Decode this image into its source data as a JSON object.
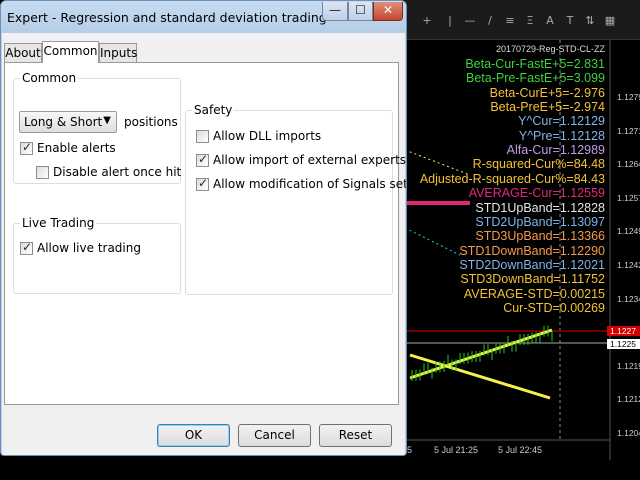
{
  "dialog": {
    "title": "Expert - Regression and standard deviation trading",
    "window_buttons": {
      "minimize": "—",
      "maximize": "☐",
      "close": "✕"
    },
    "tabs": [
      {
        "label": "About",
        "active": false
      },
      {
        "label": "Common",
        "active": true
      },
      {
        "label": "Inputs",
        "active": false
      }
    ],
    "common_group": {
      "label": "Common",
      "positions_select": {
        "value": "Long & Short",
        "suffix": "positions"
      },
      "enable_alerts": {
        "label": "Enable alerts",
        "checked": true
      },
      "disable_alert_once_hit": {
        "label": "Disable alert once hit",
        "checked": false
      }
    },
    "live_trading_group": {
      "label": "Live Trading",
      "allow_live_trading": {
        "label": "Allow live trading",
        "checked": true
      }
    },
    "safety_group": {
      "label": "Safety",
      "allow_dll": {
        "label": "Allow DLL imports",
        "checked": false
      },
      "allow_external_experts": {
        "label": "Allow import of external experts",
        "checked": true
      },
      "allow_signals_mod": {
        "label": "Allow modification of Signals settings",
        "checked": true
      }
    },
    "buttons": {
      "ok": "OK",
      "cancel": "Cancel",
      "reset": "Reset"
    }
  },
  "chart": {
    "title": "20170729-Reg-STD-CL-ZZ",
    "indicators": [
      {
        "text": "Beta-Cur-FastE+5=2.831",
        "color": "#3cd23c"
      },
      {
        "text": "Beta-Pre-FastE+5=3.099",
        "color": "#3cd23c"
      },
      {
        "text": "Beta-CurE+5=-2.976",
        "color": "#f2c233"
      },
      {
        "text": "Beta-PreE+5=-2.974",
        "color": "#f2c233"
      },
      {
        "text": "Y^Cur=1.12129",
        "color": "#7fb3e6"
      },
      {
        "text": "Y^Pre=1.12128",
        "color": "#7fb3e6"
      },
      {
        "text": "Alfa-Cur=1.12989",
        "color": "#c39be6"
      },
      {
        "text": "R-squared-Cur%=84.48",
        "color": "#f2c233"
      },
      {
        "text": "Adjusted-R-squared-Cur%=84.43",
        "color": "#f2c233"
      },
      {
        "text": "AVERAGE-Cur=1.12559",
        "color": "#e0287a"
      },
      {
        "text": "STD1UpBand=1.12828",
        "color": "#e6e6e6"
      },
      {
        "text": "STD2UpBand=1.13097",
        "color": "#7fb3e6"
      },
      {
        "text": "STD3UpBand=1.13366",
        "color": "#f29a4a"
      },
      {
        "text": "STD1DownBand=1.12290",
        "color": "#f29a4a"
      },
      {
        "text": "STD2DownBand=1.12021",
        "color": "#7fb3e6"
      },
      {
        "text": "STD3DownBand=1.11752",
        "color": "#f2c233"
      },
      {
        "text": "AVERAGE-STD=0.00215",
        "color": "#f2c233"
      },
      {
        "text": "Cur-STD=0.00269",
        "color": "#f2c233"
      }
    ],
    "price_ticks": [
      "1.1279",
      "1.1271",
      "1.1264",
      "1.1257",
      "1.1249",
      "1.1242",
      "1.1234",
      "1.1227",
      "1.1219",
      "1.1212",
      "1.1204"
    ],
    "price_labels": [
      {
        "text": "1.1227",
        "bg": "#d40000",
        "color": "#fff"
      },
      {
        "text": "1.1225",
        "bg": "#ffffff",
        "color": "#000"
      }
    ],
    "time_ticks": [
      "5",
      "5 Jul 21:25",
      "5 Jul 22:45"
    ],
    "colors": {
      "yellow": "#f6f04a",
      "green": "#22c722",
      "pink": "#e0287a",
      "red": "#d40000"
    }
  }
}
